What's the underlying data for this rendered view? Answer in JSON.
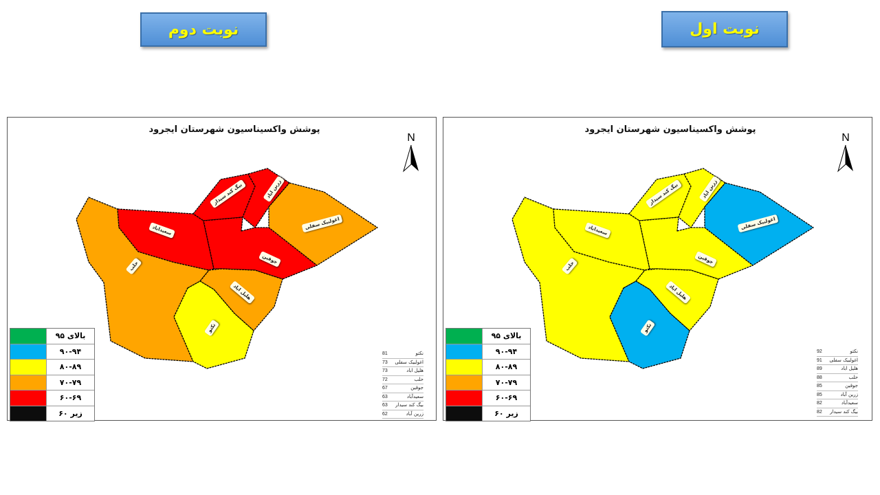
{
  "rounds": {
    "first_label": "نوبت اول",
    "second_label": "نوبت دوم"
  },
  "map_title": "پوشش واکسیناسیون شهرستان ایجرود",
  "north_letter": "N",
  "legend": [
    {
      "label": "بالای ۹۵",
      "color": "#00b050"
    },
    {
      "label": "۹۰-۹۴",
      "color": "#00b0f0"
    },
    {
      "label": "۸۰-۸۹",
      "color": "#ffff00"
    },
    {
      "label": "۷۰-۷۹",
      "color": "#ffa500"
    },
    {
      "label": "۶۰-۶۹",
      "color": "#ff0000"
    },
    {
      "label": "زیر ۶۰",
      "color": "#0d0d0d"
    }
  ],
  "round_1": {
    "ranking": [
      {
        "name": "نکتو",
        "value": "92"
      },
      {
        "name": "اغولبیک سفلی",
        "value": "91"
      },
      {
        "name": "هلیل اباد",
        "value": "89"
      },
      {
        "name": "حلب",
        "value": "88"
      },
      {
        "name": "جوقین",
        "value": "85"
      },
      {
        "name": "زرین آباد",
        "value": "85"
      },
      {
        "name": "سعیدآباد",
        "value": "82"
      },
      {
        "name": "بیگ کند سیدار",
        "value": "82"
      }
    ],
    "map_labels": [
      {
        "text": "بیگ کند سیدار"
      },
      {
        "text": "زرین اباد"
      },
      {
        "text": "اغولبیک سفلی"
      },
      {
        "text": "سعیداباد"
      },
      {
        "text": "جوقین"
      },
      {
        "text": "حلب"
      },
      {
        "text": "هلیل اباد"
      },
      {
        "text": "نکتو"
      }
    ]
  },
  "round_2": {
    "ranking": [
      {
        "name": "نکتو",
        "value": "81"
      },
      {
        "name": "اغولبیک سفلی",
        "value": "73"
      },
      {
        "name": "هلیل اباد",
        "value": "73"
      },
      {
        "name": "حلب",
        "value": "72"
      },
      {
        "name": "جوقین",
        "value": "67"
      },
      {
        "name": "سعیدآباد",
        "value": "63"
      },
      {
        "name": "بیگ کند سیدار",
        "value": "63"
      },
      {
        "name": "زرین آباد",
        "value": "62"
      }
    ],
    "map_labels": [
      {
        "text": "بیگ کند سیدار"
      },
      {
        "text": "زرین اباد"
      },
      {
        "text": "اغولبیک سفلی"
      },
      {
        "text": "سعیداباد"
      },
      {
        "text": "جوقین"
      },
      {
        "text": "حلب"
      },
      {
        "text": "هلیل اباد"
      },
      {
        "text": "نکتو"
      }
    ]
  },
  "region_colors": {
    "round_1": {
      "halab": "#ffff00",
      "saeedabad": "#ffff00",
      "beigkand": "#ffff00",
      "zarinabad": "#ffff00",
      "aghoulbeik": "#00b0f0",
      "jougin": "#ffff00",
      "halilabad": "#ffff00",
      "nakto": "#00b0f0"
    },
    "round_2": {
      "halab": "#ffa500",
      "saeedabad": "#ff0000",
      "beigkand": "#ff0000",
      "zarinabad": "#ff0000",
      "aghoulbeik": "#ffa500",
      "jougin": "#ff0000",
      "halilabad": "#ffa500",
      "nakto": "#ffff00"
    }
  }
}
